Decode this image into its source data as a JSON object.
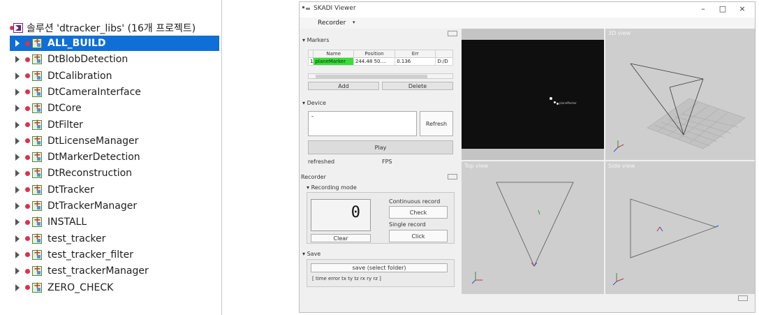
{
  "solution_explorer": {
    "root_label": "솔루션 'dtracker_libs' (16개 프로젝트)",
    "projects": [
      {
        "label": "ALL_BUILD",
        "selected": true
      },
      {
        "label": "DtBlobDetection",
        "selected": false
      },
      {
        "label": "DtCalibration",
        "selected": false
      },
      {
        "label": "DtCameraInterface",
        "selected": false
      },
      {
        "label": "DtCore",
        "selected": false
      },
      {
        "label": "DtFilter",
        "selected": false
      },
      {
        "label": "DtLicenseManager",
        "selected": false
      },
      {
        "label": "DtMarkerDetection",
        "selected": false
      },
      {
        "label": "DtReconstruction",
        "selected": false
      },
      {
        "label": "DtTracker",
        "selected": false
      },
      {
        "label": "DtTrackerManager",
        "selected": false
      },
      {
        "label": "INSTALL",
        "selected": false
      },
      {
        "label": "test_tracker",
        "selected": false
      },
      {
        "label": "test_tracker_filter",
        "selected": false
      },
      {
        "label": "test_trackerManager",
        "selected": false
      },
      {
        "label": "ZERO_CHECK",
        "selected": false
      }
    ]
  },
  "viewer": {
    "title": "SKADI Viewer",
    "window_buttons": {
      "minimize": "–",
      "maximize": "□",
      "close": "×"
    },
    "menu": {
      "recorder": "Recorder",
      "arrow": "▾"
    },
    "markers": {
      "section": "Markers",
      "columns": [
        "Name",
        "Position",
        "Err",
        ""
      ],
      "rows": [
        {
          "index": "1",
          "name": "planeMarker",
          "position": "244.48   50....",
          "err": "0.136",
          "path": "D:/D"
        }
      ],
      "add_label": "Add",
      "delete_label": "Delete"
    },
    "device": {
      "section": "Device",
      "list_value": "-",
      "refresh_label": "Refresh",
      "play_label": "Play",
      "status": "refreshed",
      "fps_label": "FPS"
    },
    "recorder": {
      "section": "Recorder",
      "recording_mode": "Recording mode",
      "counter": "0",
      "clear_label": "Clear",
      "continuous_label": "Continuous record",
      "check_label": "Check",
      "single_label": "Single record",
      "click_label": "Click"
    },
    "save": {
      "section": "Save",
      "button_label": "save (select folder)",
      "format": "[ time  error   tx      ty       tz       rx       ry       rz ]"
    },
    "views": {
      "top": "Top view",
      "side": "Side view",
      "three_d": "3D view"
    },
    "camera_label": "planeMarker",
    "colors": {
      "selection": "#0f6fd6",
      "marker_green": "#34e034",
      "view_bg": "#cecece"
    }
  }
}
